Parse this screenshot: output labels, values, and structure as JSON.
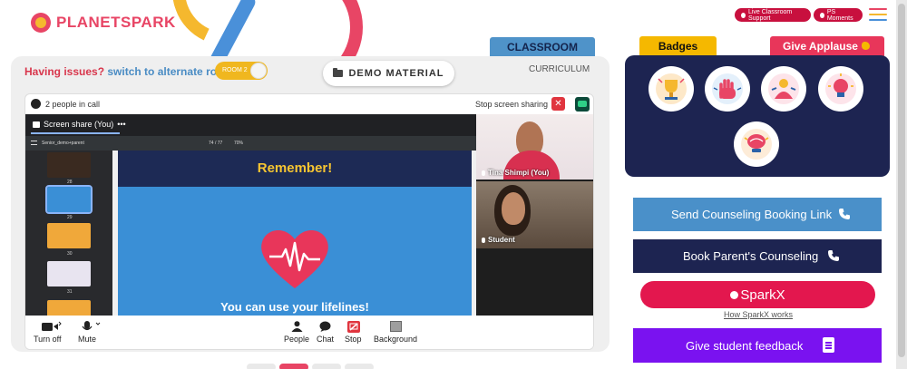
{
  "brand": {
    "logo_text": "PLANETSPARK"
  },
  "header": {
    "live_support": "Live Classroom Support",
    "ps_moments": "PS Moments",
    "menu_colors": [
      "#e84565",
      "#f5b82e",
      "#4a90d9"
    ]
  },
  "classroom": {
    "tab_classroom": "CLASSROOM",
    "tab_curriculum": "CURRICULUM",
    "issues_text": "Having issues?",
    "alternate_link": "switch to alternate room",
    "room_toggle": "ROOM 2",
    "demo_button": "DEMO MATERIAL"
  },
  "call": {
    "people_count": "2 people in call",
    "stop_sharing": "Stop screen sharing",
    "share_tab": "Screen share (You)",
    "pdf_name": "Senior_demo+parent",
    "pdf_pages": "74 / 77",
    "pdf_zoom": "70%",
    "thumb_numbers": [
      "28",
      "29",
      "30",
      "31"
    ],
    "slide_title": "Remember!",
    "slide_caption": "You can use your lifelines!",
    "participants": [
      {
        "name": "Tina Shimpi (You)"
      },
      {
        "name": "Student"
      }
    ],
    "controls": {
      "turn_off": "Turn off",
      "mute": "Mute",
      "people": "People",
      "chat": "Chat",
      "stop": "Stop",
      "background": "Background"
    }
  },
  "side": {
    "tab_badges": "Badges",
    "tab_applause": "Give Applause",
    "badges": [
      {
        "icon": "trophy-badge-icon"
      },
      {
        "icon": "hand-stop-badge-icon"
      },
      {
        "icon": "person-star-badge-icon"
      },
      {
        "icon": "lightbulb-badge-icon"
      },
      {
        "icon": "brain-badge-icon"
      }
    ],
    "send_counseling": "Send Counseling Booking Link",
    "book_parent": "Book Parent's Counseling",
    "sparkx": "SparkX",
    "how_sparkx": "How SparkX works",
    "feedback": "Give student feedback"
  },
  "colors": {
    "brand_red": "#e84565",
    "brand_yellow": "#f5b82e",
    "navy": "#1d2451",
    "blue": "#4a90c9",
    "purple": "#7a12f0"
  }
}
